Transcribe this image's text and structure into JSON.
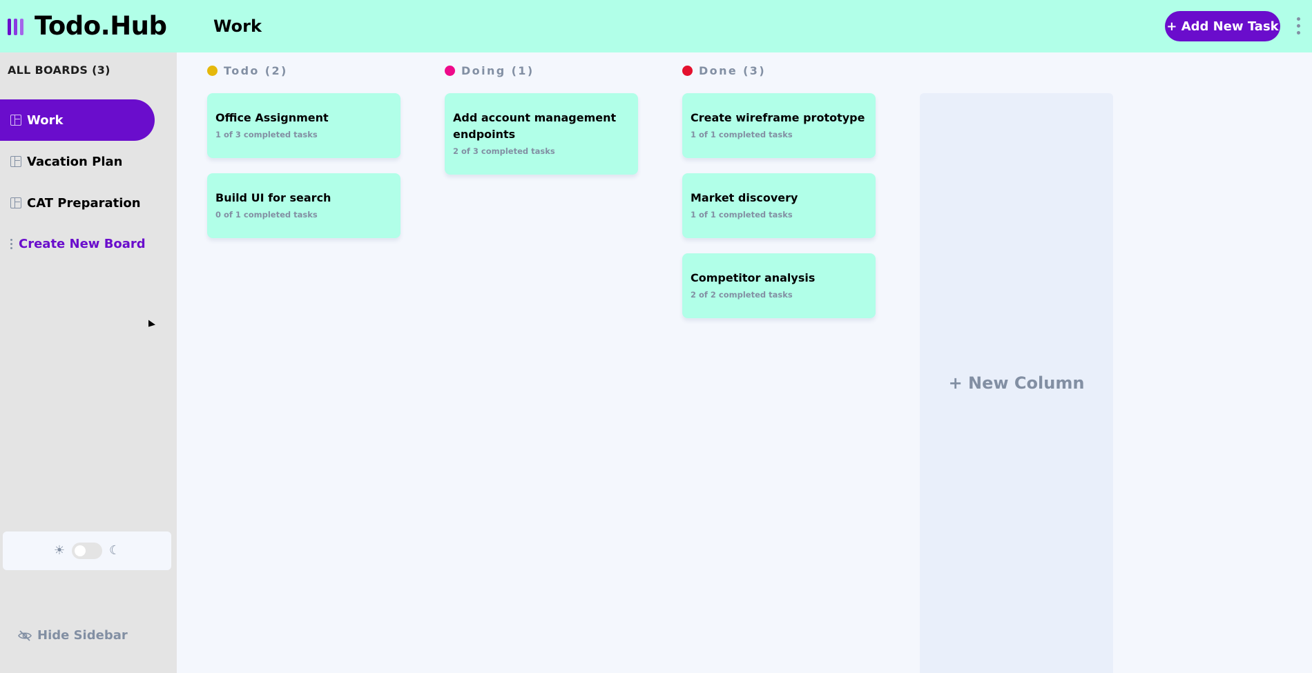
{
  "app": {
    "logo_text": "Todo.Hub"
  },
  "header": {
    "board_title": "Work",
    "add_task_label": "+ Add New Task",
    "more_icon": "vertical-ellipsis-icon"
  },
  "sidebar": {
    "all_boards_label": "ALL BOARDS (3)",
    "boards": [
      {
        "label": "Work",
        "active": true
      },
      {
        "label": "Vacation Plan",
        "active": false
      },
      {
        "label": "CAT Preparation",
        "active": false
      }
    ],
    "create_board_label": "Create New Board",
    "theme": {
      "mode": "light",
      "sun_icon": "☀",
      "moon_icon": "☾"
    },
    "hide_sidebar_label": "Hide Sidebar"
  },
  "columns": [
    {
      "header": "Todo (2)",
      "color": "#e5b80b",
      "tasks": [
        {
          "title": "Office Assignment",
          "subtasks": "1 of 3 completed tasks"
        },
        {
          "title": "Build UI for search",
          "subtasks": "0 of 1 completed tasks"
        }
      ]
    },
    {
      "header": "Doing (1)",
      "color": "#ee0a8a",
      "tasks": [
        {
          "title": "Add account management endpoints",
          "subtasks": "2 of 3 completed tasks"
        }
      ]
    },
    {
      "header": "Done (3)",
      "color": "#e4112e",
      "tasks": [
        {
          "title": "Create wireframe prototype",
          "subtasks": "1 of 1 completed tasks"
        },
        {
          "title": "Market discovery",
          "subtasks": "1 of 1 completed tasks"
        },
        {
          "title": "Competitor analysis",
          "subtasks": "2 of 2 completed tasks"
        }
      ]
    }
  ],
  "new_column_label": "+ New Column",
  "colors": {
    "accent": "#6a0dcc",
    "header_bg": "#b1ffe8",
    "card_bg": "#b1ffe8",
    "sidebar_bg": "#e4e4e4",
    "board_bg": "#f4f7fd"
  }
}
